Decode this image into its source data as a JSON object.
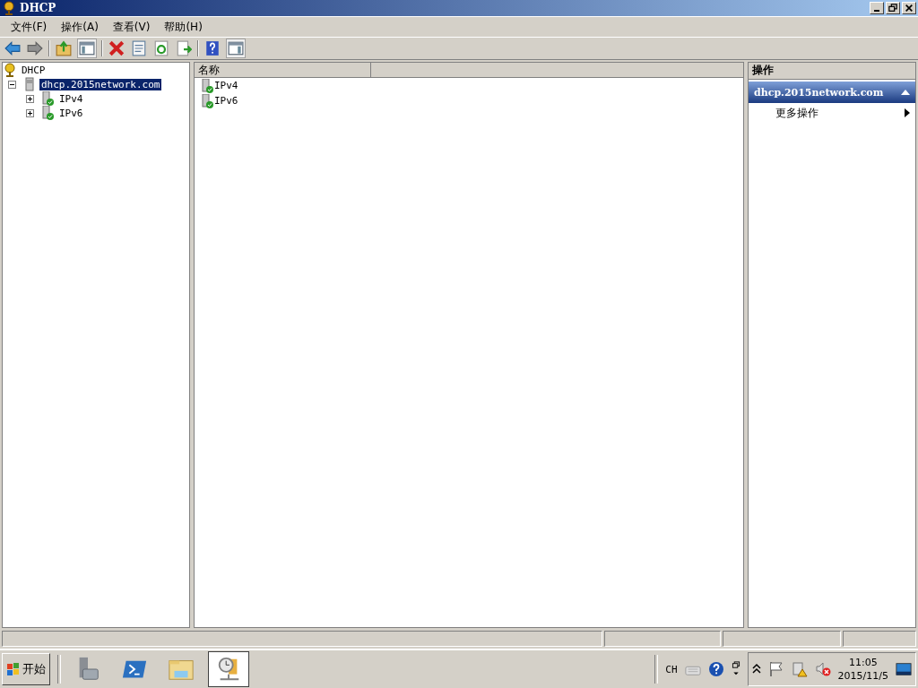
{
  "window": {
    "title": "DHCP"
  },
  "menu": [
    "文件(F)",
    "操作(A)",
    "查看(V)",
    "帮助(H)"
  ],
  "tree": {
    "label": "DHCP",
    "children": [
      {
        "label": "dhcp.2015network.com",
        "selected": true,
        "expanded": true,
        "children": [
          {
            "label": "IPv4",
            "selected": false,
            "expanded": false
          },
          {
            "label": "IPv6",
            "selected": false,
            "expanded": false
          }
        ]
      }
    ]
  },
  "list": {
    "columns": [
      "名称"
    ],
    "rows": [
      "IPv4",
      "IPv6"
    ]
  },
  "actions": {
    "title": "操作",
    "section": {
      "label": "dhcp.2015network.com",
      "expanded": true
    },
    "items": [
      "更多操作"
    ]
  },
  "taskbar": {
    "start": "开始",
    "apps": [
      {
        "kind": "server",
        "selected": false
      },
      {
        "kind": "shell",
        "selected": false
      },
      {
        "kind": "folder",
        "selected": false
      },
      {
        "kind": "dhcp",
        "selected": true
      }
    ],
    "language": "CH",
    "time": "11:05",
    "date": "2015/11/5"
  }
}
